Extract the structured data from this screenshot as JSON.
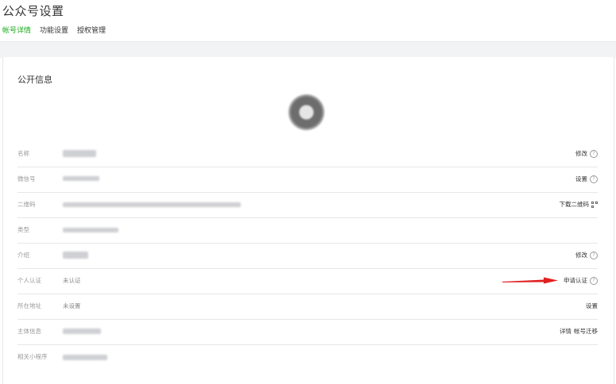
{
  "header": {
    "title": "公众号设置"
  },
  "tabs": [
    {
      "label": "帐号详情",
      "active": true
    },
    {
      "label": "功能设置",
      "active": false
    },
    {
      "label": "授权管理",
      "active": false
    }
  ],
  "section": {
    "title": "公开信息"
  },
  "rows": [
    {
      "label": "名称",
      "value": "",
      "action": "修改"
    },
    {
      "label": "微信号",
      "value": "",
      "action": "设置"
    },
    {
      "label": "二维码",
      "value": "",
      "action": "下载二维码"
    },
    {
      "label": "类型",
      "value": "",
      "action": ""
    },
    {
      "label": "介绍",
      "value": "",
      "action": "修改"
    },
    {
      "label": "个人认证",
      "value": "未认证",
      "action": "申请认证"
    },
    {
      "label": "所在地址",
      "value": "未设置",
      "action": "设置"
    },
    {
      "label": "主体信息",
      "value": "",
      "action": "详情",
      "action2": "帐号迁移"
    },
    {
      "label": "相关小程序",
      "value": "",
      "action": ""
    }
  ],
  "colors": {
    "accent": "#1aad19",
    "arrow": "#e02020"
  }
}
